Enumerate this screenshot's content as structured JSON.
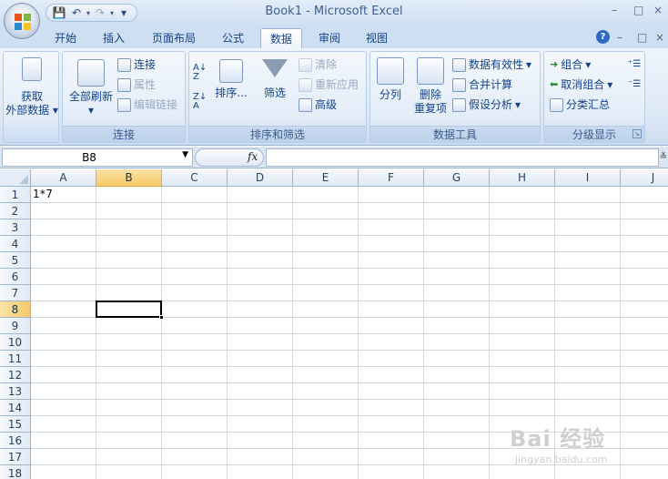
{
  "window": {
    "title": "Book1 - Microsoft Excel",
    "controls": [
      "–",
      "□",
      "×"
    ]
  },
  "qat": {
    "save": "💾",
    "undo": "↶",
    "redo": "↷",
    "more": "▾"
  },
  "tabs": [
    "开始",
    "插入",
    "页面布局",
    "公式",
    "数据",
    "审阅",
    "视图"
  ],
  "active_tab": "数据",
  "ribbon": {
    "get_external": {
      "label_line1": "获取",
      "label_line2": "外部数据"
    },
    "connections": {
      "label": "连接",
      "refresh_all": "全部刷新",
      "connect": "连接",
      "properties": "属性",
      "edit_links": "编辑链接"
    },
    "sort_filter": {
      "label": "排序和筛选",
      "sort": "排序...",
      "filter": "筛选",
      "clear": "清除",
      "reapply": "重新应用",
      "advanced": "高级"
    },
    "data_tools": {
      "label": "数据工具",
      "text_to_columns": "分列",
      "remove_dup_line1": "删除",
      "remove_dup_line2": "重复项",
      "validation": "数据有效性",
      "consolidate": "合并计算",
      "what_if": "假设分析"
    },
    "outline": {
      "label": "分级显示",
      "group": "组合",
      "ungroup": "取消组合",
      "subtotal": "分类汇总"
    }
  },
  "formula_bar": {
    "name_box": "B8",
    "fx": "fx",
    "formula": ""
  },
  "grid": {
    "columns": [
      "A",
      "B",
      "C",
      "D",
      "E",
      "F",
      "G",
      "H",
      "I",
      "J"
    ],
    "rows": [
      "1",
      "2",
      "3",
      "4",
      "5",
      "6",
      "7",
      "8",
      "9",
      "10",
      "11",
      "12",
      "13",
      "14",
      "15",
      "16",
      "17",
      "18"
    ],
    "selected_col": "B",
    "selected_row": "8",
    "cells": {
      "A1": "1*7"
    }
  },
  "watermark": {
    "main": "Bai 经验",
    "sub": "jingyan.baidu.com"
  }
}
